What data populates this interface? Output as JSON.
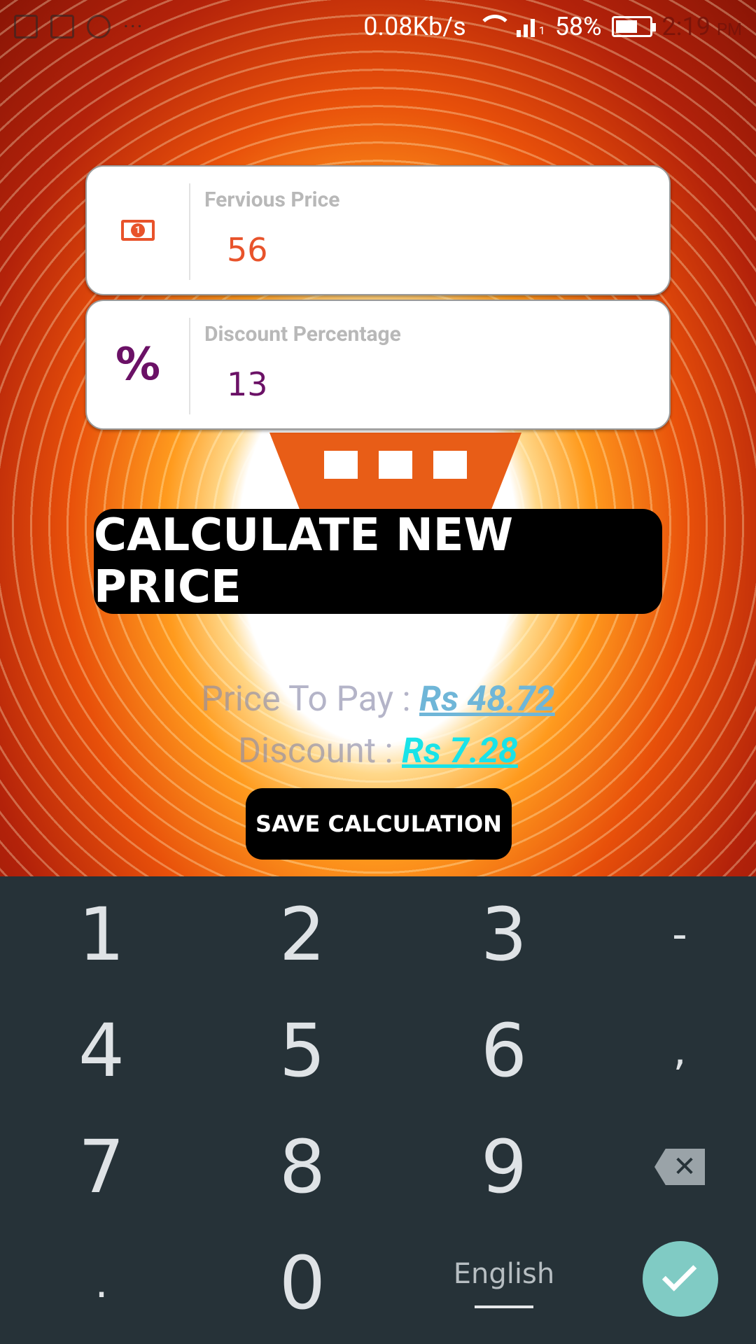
{
  "status_bar": {
    "speed": "0.08Kb/s",
    "battery_percent": "58%",
    "battery_level": 0.58,
    "time": "2:19",
    "ampm": "PM",
    "sim_label": "1",
    "overflow": "···"
  },
  "form": {
    "price_label": "Fervious Price",
    "price_value": "56",
    "price_value_color": "#e8532b",
    "discount_label": "Discount Percentage",
    "discount_value": "13",
    "discount_value_color": "#6b1166",
    "discount_icon": "%"
  },
  "calculate_button": {
    "label": "CALCULATE NEW PRICE"
  },
  "results": {
    "price_label": "Price To Pay : ",
    "price_value": "Rs 48.72",
    "price_color": "#6fb6d8",
    "discount_label": "Discount : ",
    "discount_value": "Rs 7.28",
    "discount_color": "#19e3e8"
  },
  "save_button": {
    "label": "SAVE CALCULATION"
  },
  "keyboard": {
    "keys": [
      "1",
      "2",
      "3",
      "-",
      "4",
      "5",
      "6",
      ",",
      "7",
      "8",
      "9",
      ".",
      "0"
    ],
    "language": "English",
    "backspace_icon": "backspace-icon",
    "enter_icon": "check-icon"
  }
}
